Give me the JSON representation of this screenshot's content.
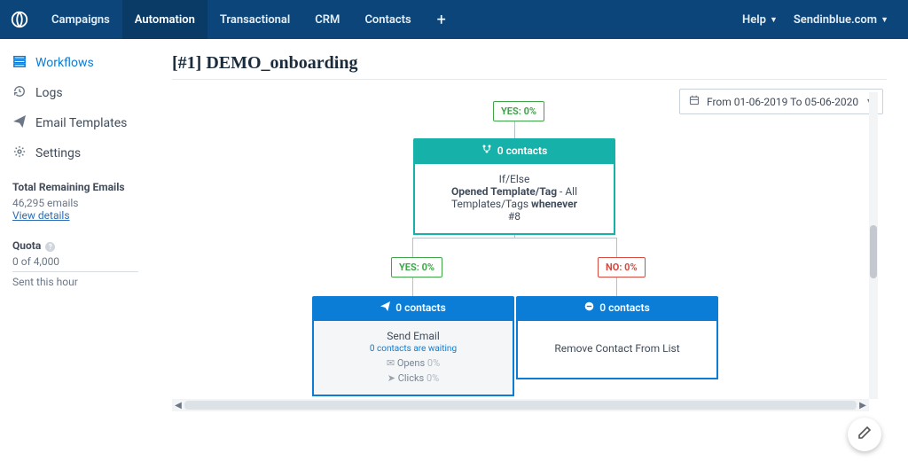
{
  "nav": {
    "items": [
      "Campaigns",
      "Automation",
      "Transactional",
      "CRM",
      "Contacts"
    ],
    "help": "Help",
    "account": "Sendinblue.com"
  },
  "sidebar": {
    "items": [
      {
        "icon": "list",
        "label": "Workflows"
      },
      {
        "icon": "history",
        "label": "Logs"
      },
      {
        "icon": "paper-plane",
        "label": "Email Templates"
      },
      {
        "icon": "gear",
        "label": "Settings"
      }
    ],
    "remaining": {
      "title": "Total Remaining Emails",
      "count": "46,295 emails",
      "view_details": "View details"
    },
    "quota": {
      "title": "Quota",
      "value": "0 of 4,000",
      "sent": "Sent this hour"
    }
  },
  "page": {
    "title": "[#1] DEMO_onboarding",
    "date_range": "From 01-06-2019 To 05-06-2020"
  },
  "flow": {
    "top_badge": "YES: 0%",
    "ifelse": {
      "header": "0 contacts",
      "line1": "If/Else",
      "line2a": "Opened Template/Tag",
      "line2b": " - All Templates/Tags ",
      "line2c": "whenever",
      "line3": "#8"
    },
    "yes_badge": "YES: 0%",
    "no_badge": "NO: 0%",
    "send_email": {
      "header": "0 contacts",
      "title": "Send Email",
      "waiting": "0 contacts are waiting",
      "opens_label": "Opens",
      "opens_val": "0%",
      "clicks_label": "Clicks",
      "clicks_val": "0%"
    },
    "remove": {
      "header": "0 contacts",
      "title": "Remove Contact From List"
    }
  }
}
